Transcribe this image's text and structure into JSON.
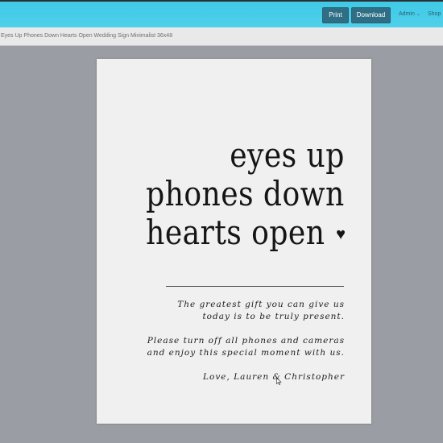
{
  "toolbar": {
    "print_label": "Print",
    "download_label": "Download",
    "admin_label": "Admin",
    "shop_label": "Shop",
    "accent_color": "#4fd0ea",
    "button_color": "#2f6f86"
  },
  "document": {
    "title": "Eyes Up Phones Down Hearts Open Wedding Sign Minimalist 36x48"
  },
  "sign": {
    "headline_line1": "eyes up",
    "headline_line2": "phones down",
    "headline_line3": "hearts open",
    "heart_glyph": "♥",
    "para1_line1": "The greatest gift you can give us",
    "para1_line2": "today is to be truly present.",
    "para2_line1": "Please turn off all phones and cameras",
    "para2_line2": "and enjoy this special moment with us.",
    "signature": "Love, Lauren & Christopher"
  }
}
